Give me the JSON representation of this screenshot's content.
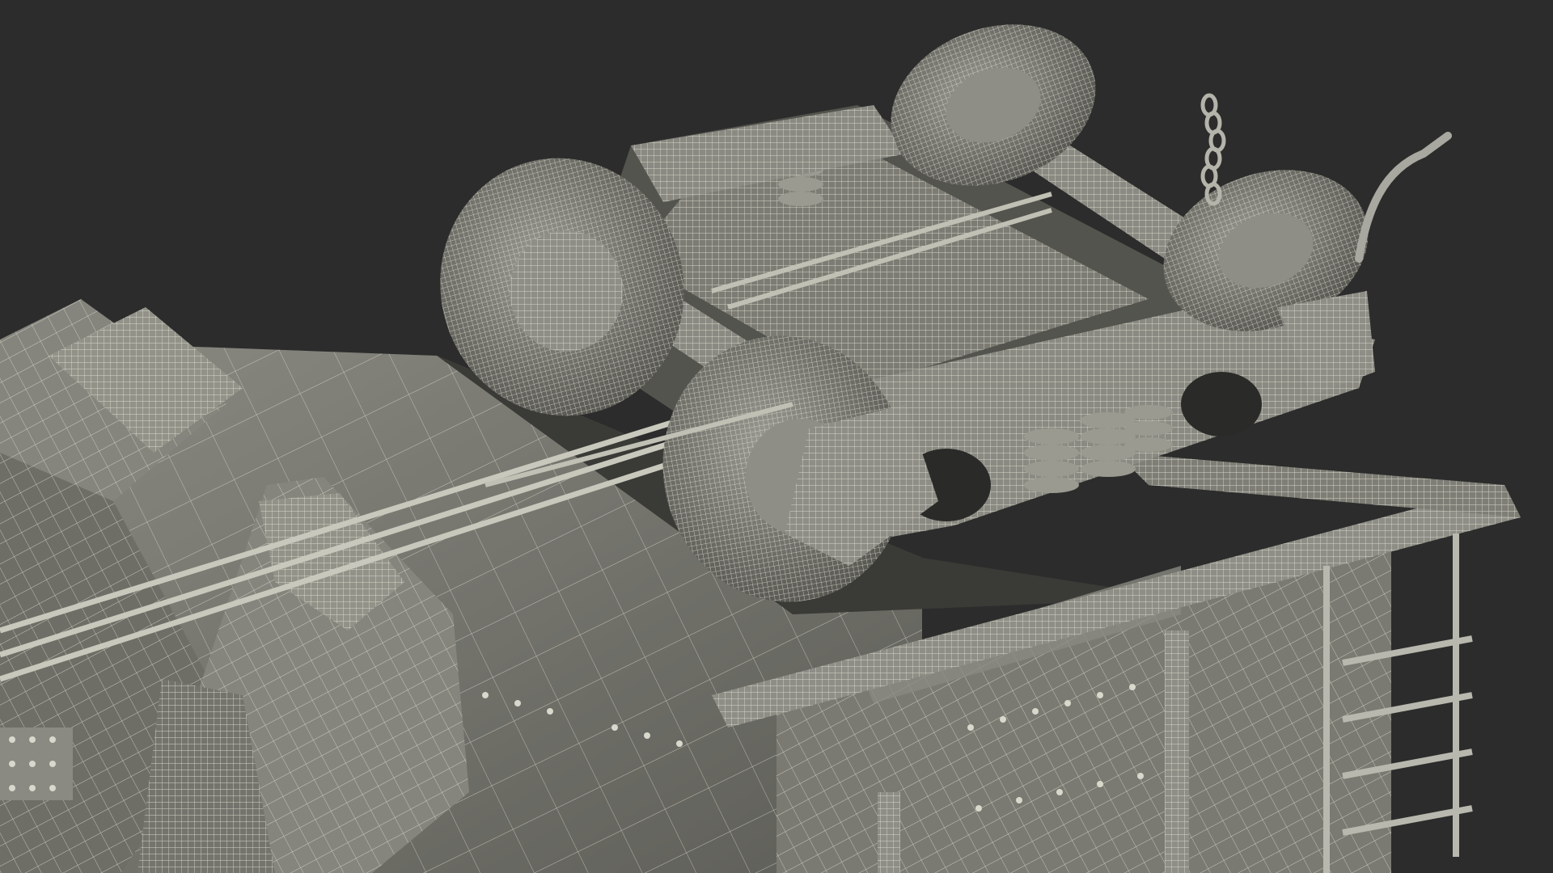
{
  "scene": {
    "subject": "railcar-truck-wireframe-render",
    "colors": {
      "background": "#2c2c2c",
      "surface_light": "#8e8e86",
      "surface_mid": "#74746c",
      "surface_dark": "#56564f",
      "shadow": "#1c1c1c",
      "wire": "#e4e4d8"
    }
  }
}
